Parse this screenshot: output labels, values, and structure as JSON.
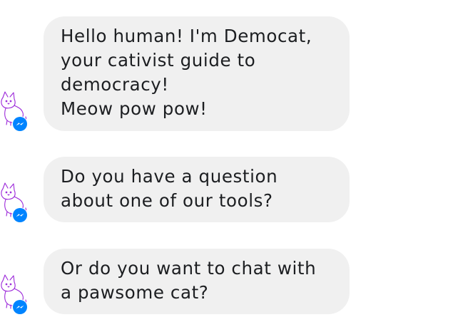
{
  "conversation": {
    "messages": [
      {
        "text": "Hello human! I'm Democat,\nyour cativist guide to\ndemocracy!\nMeow pow pow!"
      },
      {
        "text": "Do you have a question\nabout one of our tools?"
      },
      {
        "text": "Or do you want to chat with\na pawsome cat?"
      }
    ],
    "avatar_icon": "cat-icon",
    "badge_icon": "messenger-icon",
    "colors": {
      "bubble": "#f0f0f0",
      "text": "#1c1e21",
      "cat_outline": "#9b27d9",
      "messenger_blue": "#0084ff"
    }
  }
}
